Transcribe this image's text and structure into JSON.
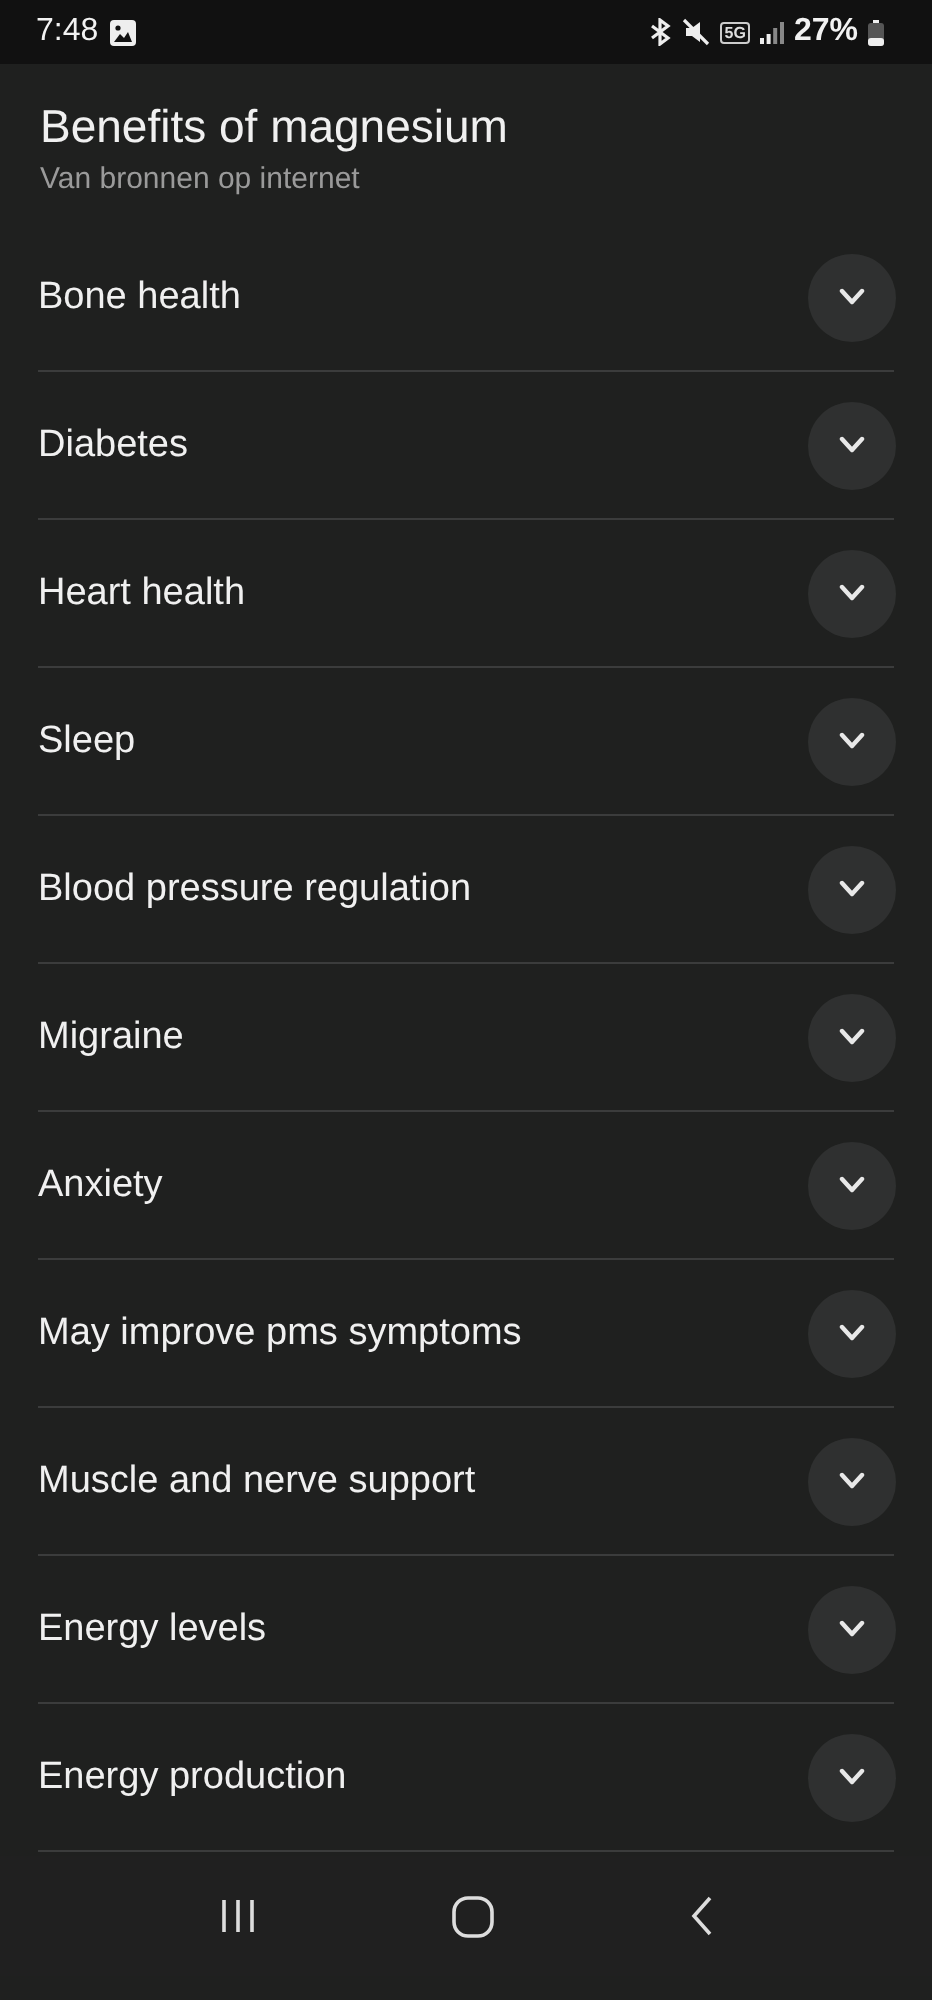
{
  "status_bar": {
    "time": "7:48",
    "network": "5G",
    "battery": "27%"
  },
  "header": {
    "title": "Benefits of magnesium",
    "subtitle": "Van bronnen op internet"
  },
  "items": [
    {
      "label": "Bone health",
      "expanded": false
    },
    {
      "label": "Diabetes",
      "expanded": false
    },
    {
      "label": "Heart health",
      "expanded": false
    },
    {
      "label": "Sleep",
      "expanded": false
    },
    {
      "label": "Blood pressure regulation",
      "expanded": false
    },
    {
      "label": "Migraine",
      "expanded": false
    },
    {
      "label": "Anxiety",
      "expanded": false
    },
    {
      "label": "May improve pms symptoms",
      "expanded": false
    },
    {
      "label": "Muscle and nerve support",
      "expanded": false
    },
    {
      "label": "Energy levels",
      "expanded": false
    },
    {
      "label": "Energy production",
      "expanded": false
    }
  ]
}
